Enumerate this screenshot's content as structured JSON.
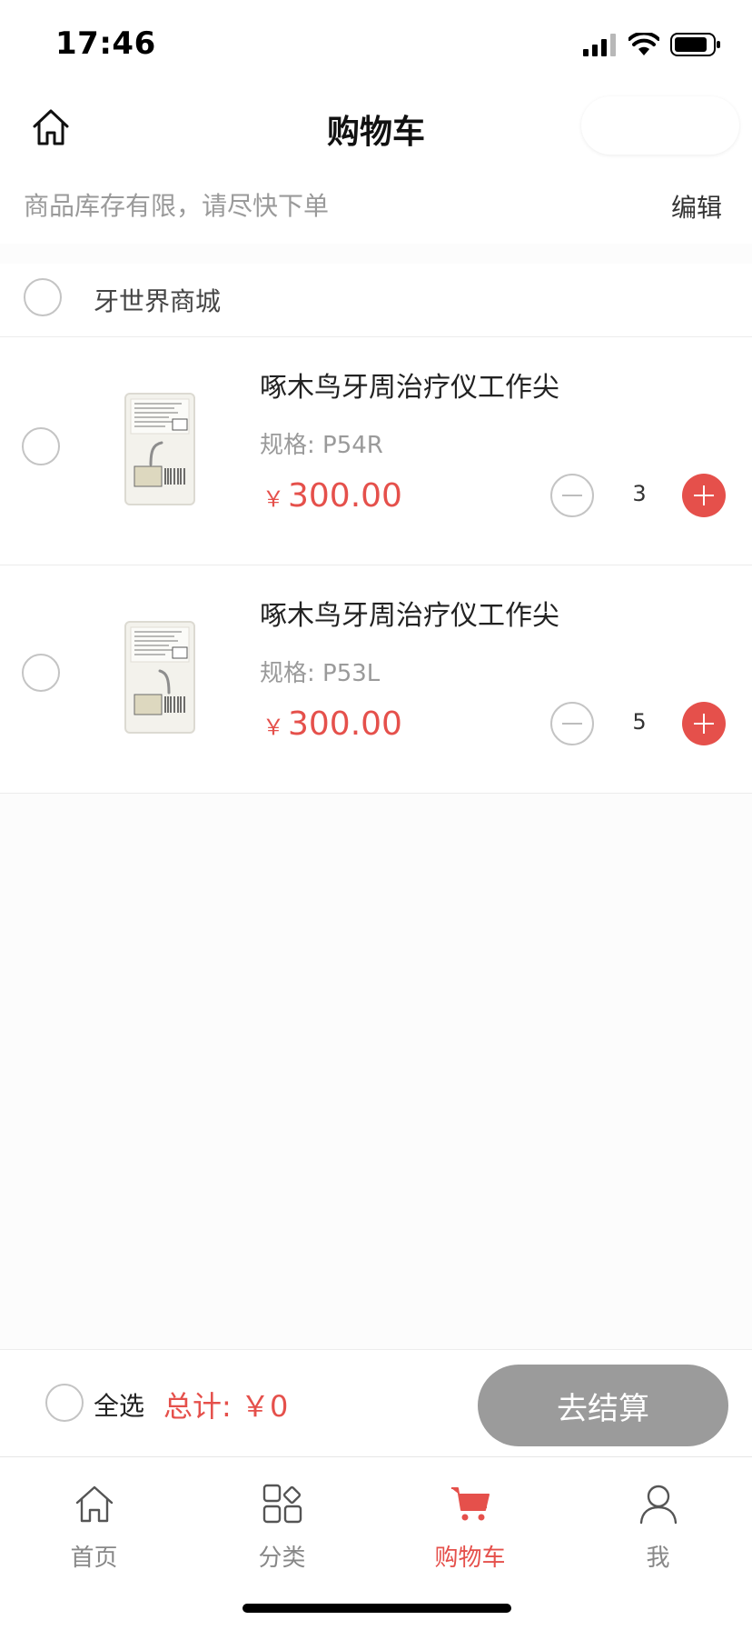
{
  "status_bar": {
    "time": "17:46"
  },
  "nav": {
    "title": "购物车"
  },
  "notice": {
    "text": "商品库存有限，请尽快下单",
    "edit_label": "编辑"
  },
  "shop": {
    "name": "牙世界商城"
  },
  "cart_items": [
    {
      "title": "啄木鸟牙周治疗仪工作尖",
      "spec": "规格: P54R",
      "currency": "￥",
      "price": "300.00",
      "quantity": "3"
    },
    {
      "title": "啄木鸟牙周治疗仪工作尖",
      "spec": "规格: P53L",
      "currency": "￥",
      "price": "300.00",
      "quantity": "5"
    }
  ],
  "checkout": {
    "select_all_label": "全选",
    "total_label": "总计: ￥0",
    "button_label": "去结算"
  },
  "tabs": [
    {
      "label": "首页",
      "icon": "home-icon",
      "active": false
    },
    {
      "label": "分类",
      "icon": "category-icon",
      "active": false
    },
    {
      "label": "购物车",
      "icon": "cart-icon",
      "active": true
    },
    {
      "label": "我",
      "icon": "user-icon",
      "active": false
    }
  ],
  "colors": {
    "accent": "#e5504b",
    "checkout_disabled": "#9b9b9b"
  }
}
